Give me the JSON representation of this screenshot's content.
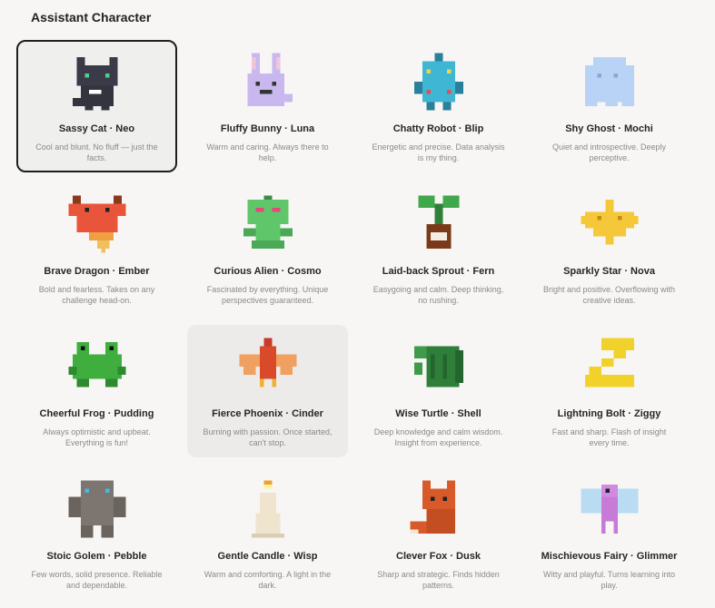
{
  "section": {
    "title": "Assistant Character"
  },
  "characters": [
    {
      "name": "Sassy Cat · Neo",
      "desc": "Cool and blunt. No fluff — just the facts.",
      "icon": "sassy-cat-icon",
      "selected": true
    },
    {
      "name": "Fluffy Bunny · Luna",
      "desc": "Warm and caring. Always there to help.",
      "icon": "fluffy-bunny-icon"
    },
    {
      "name": "Chatty Robot · Blip",
      "desc": "Energetic and precise. Data analysis is my thing.",
      "icon": "chatty-robot-icon"
    },
    {
      "name": "Shy Ghost · Mochi",
      "desc": "Quiet and introspective. Deeply perceptive.",
      "icon": "shy-ghost-icon"
    },
    {
      "name": "Brave Dragon · Ember",
      "desc": "Bold and fearless. Takes on any challenge head-on.",
      "icon": "brave-dragon-icon"
    },
    {
      "name": "Curious Alien · Cosmo",
      "desc": "Fascinated by everything. Unique perspectives guaranteed.",
      "icon": "curious-alien-icon"
    },
    {
      "name": "Laid-back Sprout · Fern",
      "desc": "Easygoing and calm. Deep thinking, no rushing.",
      "icon": "sprout-icon"
    },
    {
      "name": "Sparkly Star · Nova",
      "desc": "Bright and positive. Overflowing with creative ideas.",
      "icon": "sparkly-star-icon"
    },
    {
      "name": "Cheerful Frog · Pudding",
      "desc": "Always optimistic and upbeat. Everything is fun!",
      "icon": "cheerful-frog-icon"
    },
    {
      "name": "Fierce Phoenix · Cinder",
      "desc": "Burning with passion. Once started, can't stop.",
      "icon": "fierce-phoenix-icon",
      "hover": true
    },
    {
      "name": "Wise Turtle · Shell",
      "desc": "Deep knowledge and calm wisdom. Insight from experience.",
      "icon": "wise-turtle-icon"
    },
    {
      "name": "Lightning Bolt · Ziggy",
      "desc": "Fast and sharp. Flash of insight every time.",
      "icon": "lightning-bolt-icon"
    },
    {
      "name": "Stoic Golem · Pebble",
      "desc": "Few words, solid presence. Reliable and dependable.",
      "icon": "stoic-golem-icon"
    },
    {
      "name": "Gentle Candle · Wisp",
      "desc": "Warm and comforting. A light in the dark.",
      "icon": "gentle-candle-icon"
    },
    {
      "name": "Clever Fox · Dusk",
      "desc": "Sharp and strategic. Finds hidden patterns.",
      "icon": "clever-fox-icon"
    },
    {
      "name": "Mischievous Fairy · Glimmer",
      "desc": "Witty and playful. Turns learning into play.",
      "icon": "mischievous-fairy-icon"
    }
  ]
}
